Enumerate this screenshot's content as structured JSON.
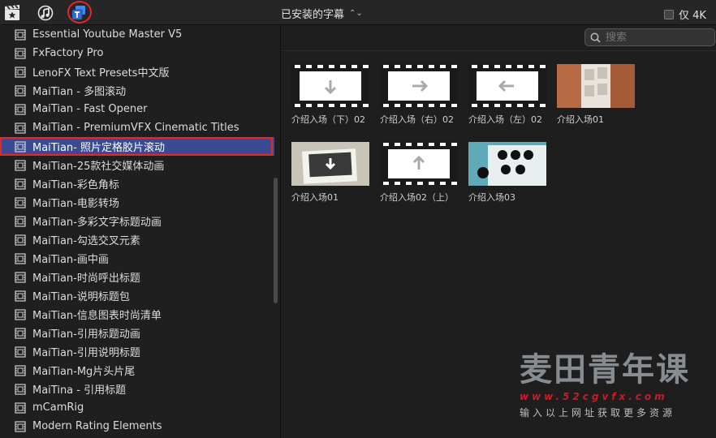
{
  "topbar": {
    "icons": [
      "clapper-star-icon",
      "music-note-icon",
      "titles-icon"
    ],
    "dropdown_label": "已安装的字幕",
    "only4k_label": "仅 4K"
  },
  "sidebar": {
    "items": [
      "Essential Youtube Master V5",
      "FxFactory Pro",
      "LenoFX Text Presets中文版",
      "MaiTian - 多图滚动",
      "MaiTian - Fast Opener",
      "MaiTian - PremiumVFX Cinematic Titles",
      "MaiTian- 照片定格胶片滚动",
      "MaiTian-25款社交媒体动画",
      "MaiTian-彩色角标",
      "MaiTian-电影转场",
      "MaiTian-多彩文字标题动画",
      "MaiTian-勾选交叉元素",
      "MaiTian-画中画",
      "MaiTian-时尚呼出标题",
      "MaiTian-说明标题包",
      "MaiTian-信息图表时尚清单",
      "MaiTian-引用标题动画",
      "MaiTian-引用说明标题",
      "MaiTian-Mg片头片尾",
      "MaiTina - 引用标题",
      "mCamRig",
      "Modern Rating Elements"
    ],
    "selected_index": 6
  },
  "search": {
    "placeholder": "搜索"
  },
  "thumbnails": [
    {
      "caption": "介绍入场（下）02",
      "style": "film-down"
    },
    {
      "caption": "介绍入场（右）02",
      "style": "film-right"
    },
    {
      "caption": "介绍入场（左）02",
      "style": "film-left"
    },
    {
      "caption": "介绍入场01",
      "style": "copper"
    },
    {
      "caption": "介绍入场01",
      "style": "gray-photo"
    },
    {
      "caption": "介绍入场02（上）",
      "style": "film-up"
    },
    {
      "caption": "介绍入场03",
      "style": "teal-icons"
    }
  ],
  "watermark": {
    "title": "麦田青年课",
    "url": "www.52cgvfx.com",
    "subtitle": "输入以上网址获取更多资源"
  },
  "colors": {
    "selection": "#3a4a93",
    "highlight_red": "#e8262b",
    "teal": "#5fa9b8",
    "copper": "#b86a45"
  }
}
